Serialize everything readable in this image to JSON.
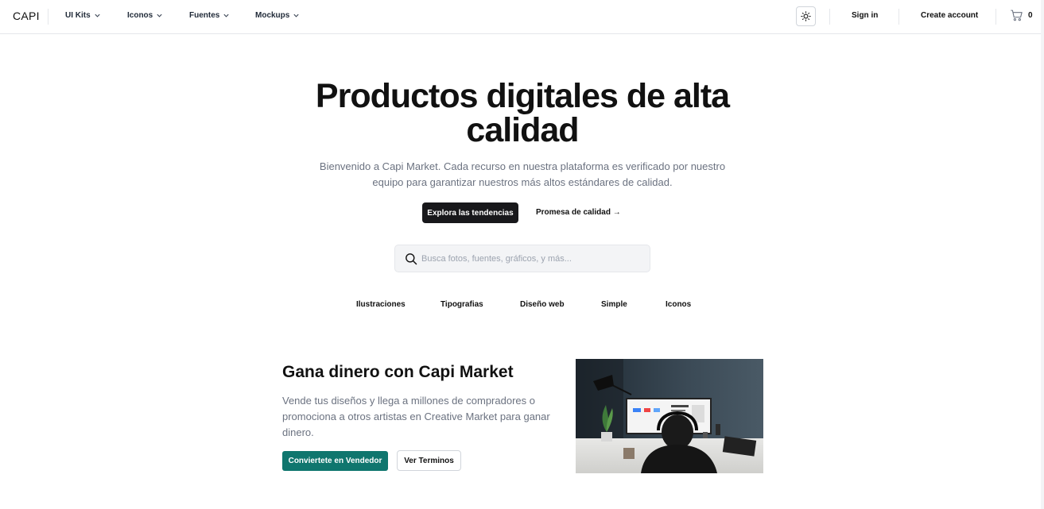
{
  "header": {
    "logo": "CAPI",
    "nav": [
      {
        "label": "UI Kits"
      },
      {
        "label": "Iconos"
      },
      {
        "label": "Fuentes"
      },
      {
        "label": "Mockups"
      }
    ],
    "sign_in": "Sign in",
    "create_account": "Create account",
    "cart_count": "0"
  },
  "hero": {
    "title": "Productos digitales de alta calidad",
    "subtitle": "Bienvenido a Capi Market. Cada recurso en nuestra plataforma es verificado por nuestro equipo para garantizar nuestros más altos estándares de calidad.",
    "primary_button": "Explora las tendencias",
    "secondary_link": "Promesa de calidad →"
  },
  "search": {
    "placeholder": "Busca fotos, fuentes, gráficos, y más..."
  },
  "categories": [
    "Ilustraciones",
    "Tipografias",
    "Diseño web",
    "Simple",
    "Iconos"
  ],
  "promo": {
    "title": "Gana dinero con Capi Market",
    "text": "Vende tus diseños y llega a millones de compradores o promociona a otros artistas en Creative Market para ganar dinero.",
    "primary_button": "Conviertete en Vendedor",
    "secondary_button": "Ver Terminos"
  },
  "colors": {
    "accent_teal": "#0f766e",
    "dark_button": "#18181b",
    "muted_text": "#6b7280"
  }
}
